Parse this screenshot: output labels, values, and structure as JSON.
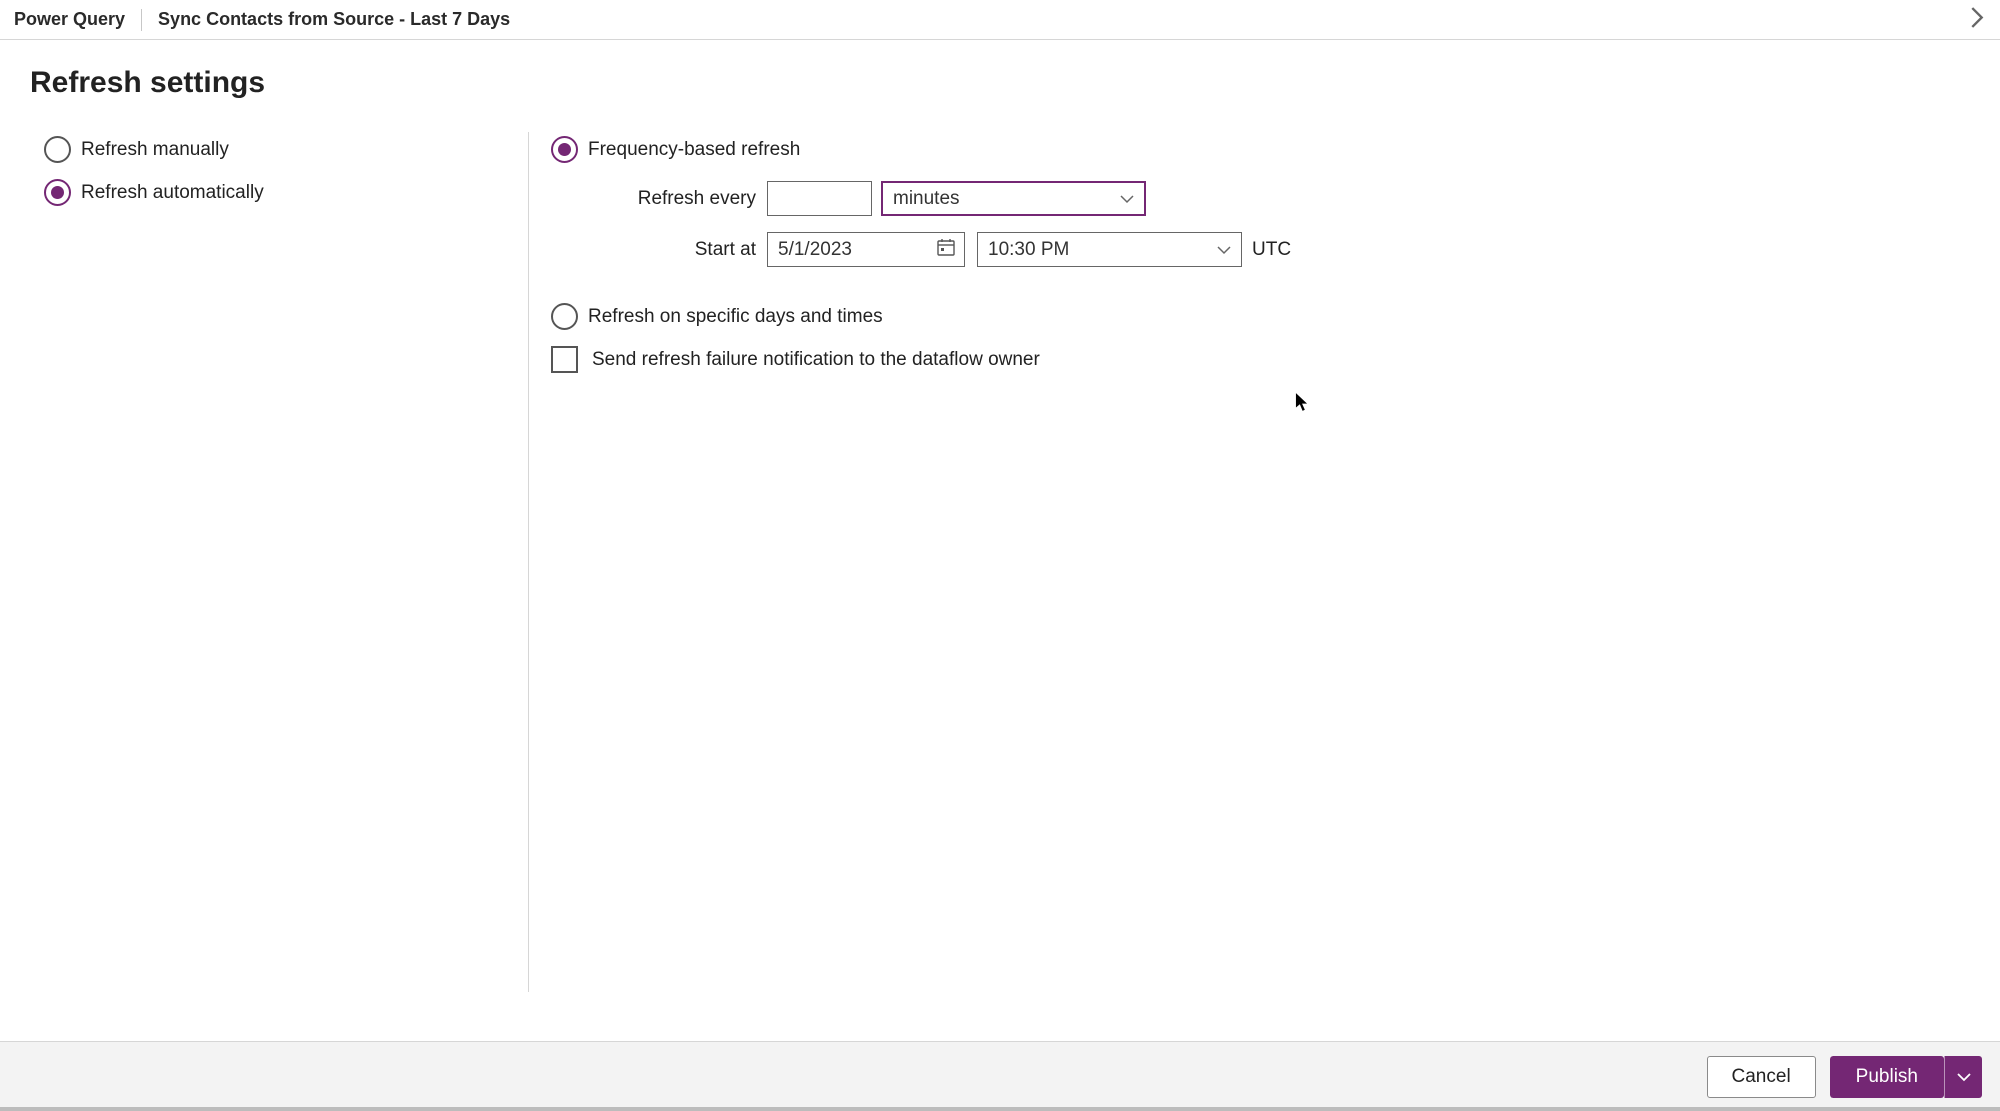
{
  "header": {
    "app_name": "Power Query",
    "flow_title": "Sync Contacts from Source - Last 7 Days"
  },
  "page": {
    "title": "Refresh settings"
  },
  "sidebar": {
    "manual_label": "Refresh manually",
    "auto_label": "Refresh automatically",
    "selected": "auto"
  },
  "main": {
    "frequency": {
      "label": "Frequency-based refresh",
      "selected": true,
      "every_label": "Refresh every",
      "interval_value": "",
      "unit_value": "minutes",
      "start_label": "Start at",
      "start_date": "5/1/2023",
      "start_time": "10:30 PM",
      "tz_label": "UTC"
    },
    "specific": {
      "label": "Refresh on specific days and times",
      "selected": false
    },
    "notify": {
      "label": "Send refresh failure notification to the dataflow owner",
      "checked": false
    }
  },
  "footer": {
    "cancel": "Cancel",
    "publish": "Publish"
  }
}
